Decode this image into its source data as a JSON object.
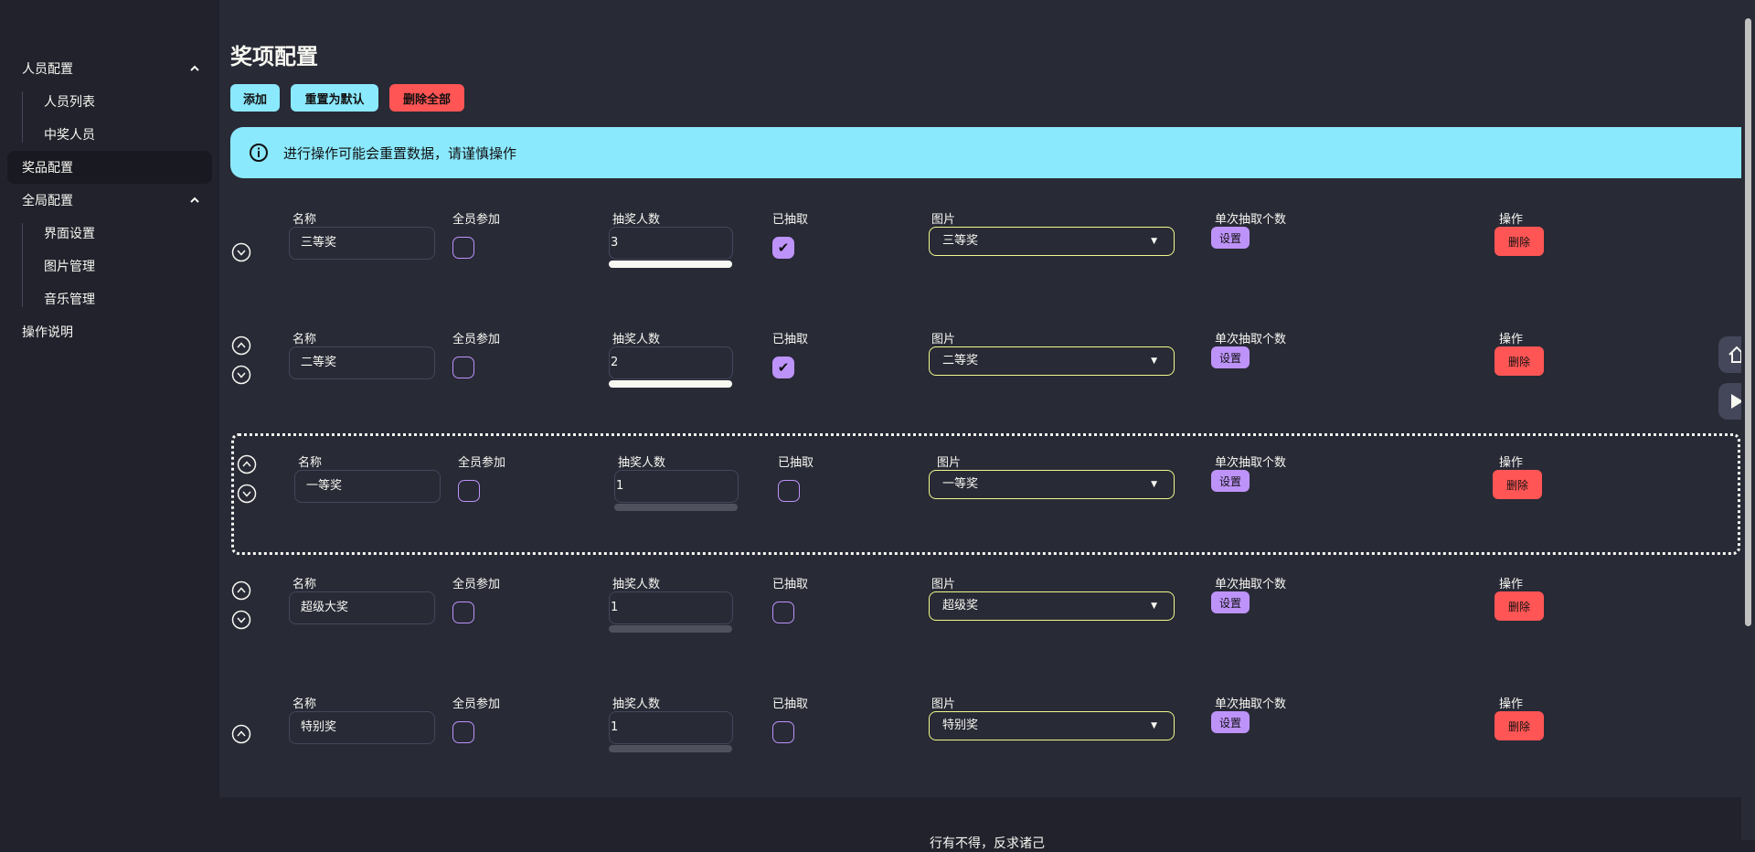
{
  "sidebar": {
    "groups": [
      {
        "label": "人员配置",
        "children": [
          "人员列表",
          "中奖人员"
        ]
      },
      {
        "label": "奖品配置",
        "active": true
      },
      {
        "label": "全局配置",
        "children": [
          "界面设置",
          "图片管理",
          "音乐管理"
        ]
      },
      {
        "label": "操作说明"
      }
    ]
  },
  "page": {
    "title": "奖项配置"
  },
  "toolbar": {
    "add": "添加",
    "reset": "重置为默认",
    "delete_all": "删除全部"
  },
  "alert": {
    "text": "进行操作可能会重置数据，请谨慎操作",
    "icon": "info-icon"
  },
  "columns": {
    "name": "名称",
    "all": "全员参加",
    "count": "抽奖人数",
    "drawn": "已抽取",
    "image": "图片",
    "per_draw": "单次抽取个数",
    "action": "操作",
    "set": "设置",
    "delete": "删除"
  },
  "prizes": [
    {
      "name": "三等奖",
      "all": false,
      "count": "3",
      "drawn": true,
      "progress": 1,
      "image": "三等奖"
    },
    {
      "name": "二等奖",
      "all": false,
      "count": "2",
      "drawn": true,
      "progress": 1,
      "image": "二等奖"
    },
    {
      "name": "一等奖",
      "all": false,
      "count": "1",
      "drawn": false,
      "progress": 0,
      "image": "一等奖"
    },
    {
      "name": "超级大奖",
      "all": false,
      "count": "1",
      "drawn": false,
      "progress": 0,
      "image": "超级奖"
    },
    {
      "name": "特别奖",
      "all": false,
      "count": "1",
      "drawn": false,
      "progress": 0,
      "image": "特别奖"
    }
  ],
  "footer": {
    "text": "行有不得，反求诸己"
  },
  "colors": {
    "accent_cyan": "#8be9fd",
    "danger": "#ff5555",
    "purple": "#bd93f9",
    "yellow": "#f1fa8c",
    "bg": "#282a36"
  }
}
